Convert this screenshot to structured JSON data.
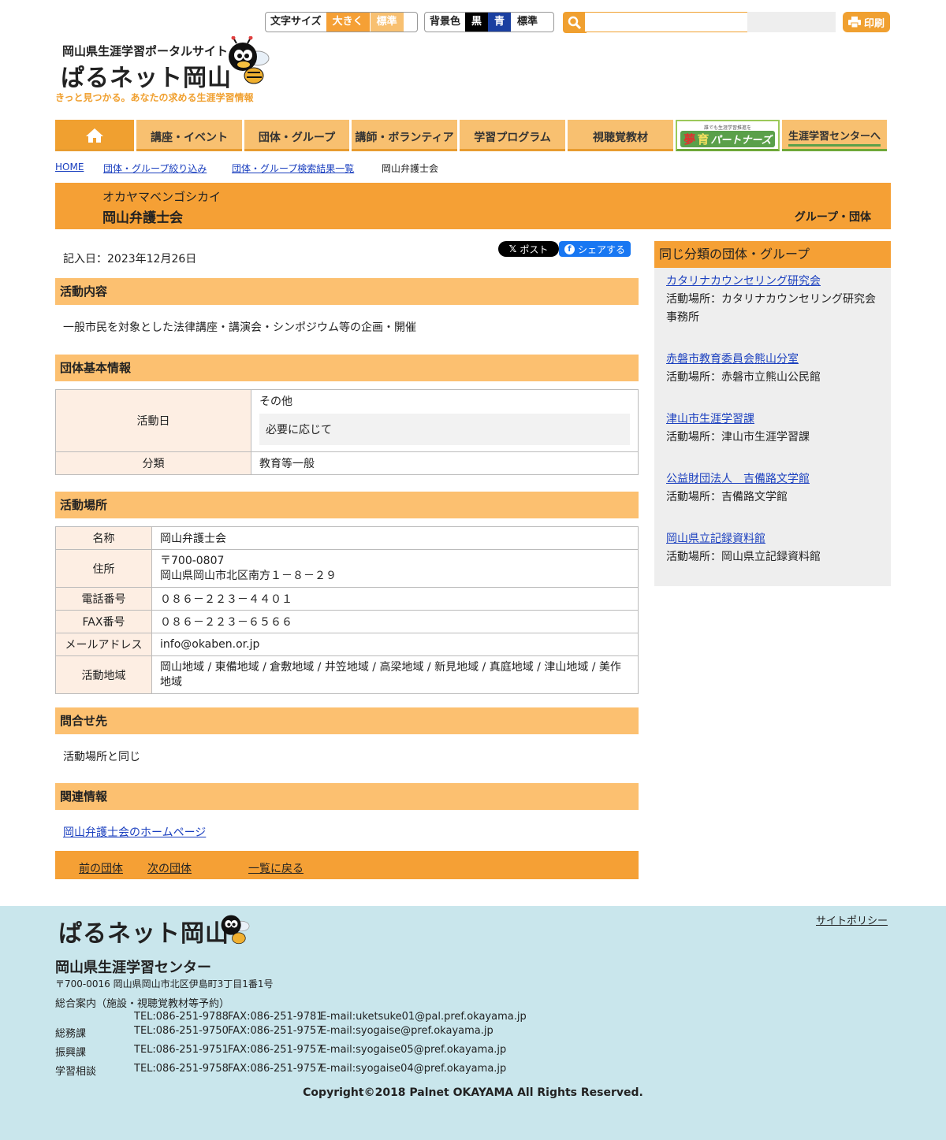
{
  "header": {
    "font_size_label": "文字サイズ",
    "font_large": "大きく",
    "font_standard": "標準",
    "bg_label": "背景色",
    "bg_black": "黒",
    "bg_blue": "青",
    "bg_standard": "標準",
    "search_placeholder": "",
    "print_label": "印刷",
    "logo_sub": "岡山県生涯学習ポータルサイト",
    "logo_main": "ぱるネット岡山",
    "logo_tagline": "きっと見つかる。あなたの求める生涯学習情報"
  },
  "nav": {
    "items": [
      "講座・イベント",
      "団体・グループ",
      "講師・ボランティア",
      "学習プログラム",
      "視聴覚教材"
    ],
    "partners_small": "誰でも生涯学習推進を",
    "partners_label_1": "夢",
    "partners_label_2": "育",
    "partners_label_3": "パートナーズ",
    "center_label": "生涯学習センターへ"
  },
  "breadcrumb": {
    "home": "HOME",
    "filter": "団体・グループ絞り込み",
    "results": "団体・グループ検索結果一覧",
    "current": "岡山弁護士会"
  },
  "title": {
    "kana": "オカヤマベンゴシカイ",
    "name": "岡山弁護士会",
    "category": "グループ・団体"
  },
  "main": {
    "entry_date": "記入日：2023年12月26日",
    "share_x": "ポスト",
    "share_fb": "シェアする",
    "activity_heading": "活動内容",
    "activity_text": "一般市民を対象とした法律講座・講演会・シンポジウム等の企画・開催",
    "basic_heading": "団体基本情報",
    "basic": {
      "day_label": "活動日",
      "day_value": "その他",
      "day_note": "必要に応じて",
      "category_label": "分類",
      "category_value": "教育等一般"
    },
    "place_heading": "活動場所",
    "place": {
      "name_label": "名称",
      "name_value": "岡山弁護士会",
      "address_label": "住所",
      "postal": "〒700-0807",
      "address": "岡山県岡山市北区南方１－８－２９",
      "tel_label": "電話番号",
      "tel_value": "０８６－２２３－４４０１",
      "fax_label": "FAX番号",
      "fax_value": "０８６－２２３－６５６６",
      "mail_label": "メールアドレス",
      "mail_value": "info@okaben.or.jp",
      "area_label": "活動地域",
      "area_value": "岡山地域 / 東備地域 / 倉敷地域 / 井笠地域 / 高梁地域 / 新見地域 / 真庭地域 / 津山地域 / 美作地域"
    },
    "contact_heading": "問合せ先",
    "contact_text": "活動場所と同じ",
    "related_heading": "関連情報",
    "related_link": "岡山弁護士会のホームページ",
    "prev": "前の団体",
    "next": "次の団体",
    "back": "一覧に戻る"
  },
  "side": {
    "heading": "同じ分類の団体・グループ",
    "items": [
      {
        "name": "カタリナカウンセリング研究会",
        "place": "活動場所：カタリナカウンセリング研究会事務所"
      },
      {
        "name": "赤磐市教育委員会熊山分室",
        "place": "活動場所：赤磐市立熊山公民館"
      },
      {
        "name": "津山市生涯学習課",
        "place": "活動場所：津山市生涯学習課"
      },
      {
        "name": "公益財団法人　吉備路文学館",
        "place": "活動場所：吉備路文学館"
      },
      {
        "name": "岡山県立記録資料館",
        "place": "活動場所：岡山県立記録資料館"
      }
    ]
  },
  "footer": {
    "logo": "ぱるネット岡山",
    "policy": "サイトポリシー",
    "org": "岡山県生涯学習センター",
    "address": "〒700-0016 岡山県岡山市北区伊島町3丁目1番1号",
    "general": "総合案内（施設・視聴覚教材等予約）",
    "rows": [
      {
        "label": "",
        "tel": "TEL:086-251-9788",
        "fax": "FAX:086-251-9781",
        "mail": "E-mail:uketsuke01@pal.pref.okayama.jp"
      },
      {
        "label": "総務課",
        "tel": "TEL:086-251-9750",
        "fax": "FAX:086-251-9757",
        "mail": "E-mail:syogaise@pref.okayama.jp"
      },
      {
        "label": "振興課",
        "tel": "TEL:086-251-9751",
        "fax": "FAX:086-251-9757",
        "mail": "E-mail:syogaise05@pref.okayama.jp"
      },
      {
        "label": "学習相談",
        "tel": "TEL:086-251-9758",
        "fax": "FAX:086-251-9757",
        "mail": "E-mail:syogaise04@pref.okayama.jp"
      }
    ],
    "copyright": "Copyright©2018 Palnet OKAYAMA All Rights Reserved."
  },
  "colors": {
    "accent": "#f5a035",
    "section_bg": "#fcc070",
    "footer_bg": "#c9e6ec",
    "link": "#1a3fbf"
  },
  "icons": [
    "search-icon",
    "print-icon",
    "home-icon",
    "x-logo-icon",
    "facebook-icon",
    "bee-mascot-icon"
  ]
}
